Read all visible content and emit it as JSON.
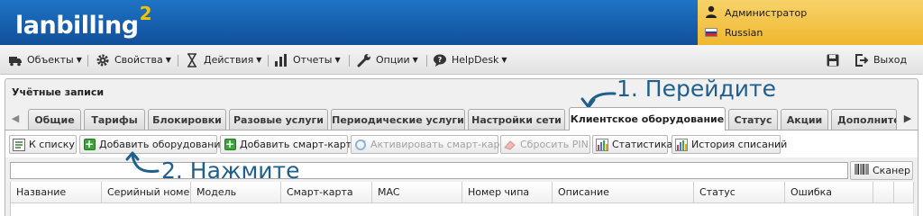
{
  "header": {
    "logo_text": "lanbilling",
    "logo_superscript": "2",
    "user": {
      "name": "Администратор",
      "icon": "user-icon"
    },
    "language": {
      "label": "Russian",
      "icon": "russian-flag-icon"
    },
    "colors": {
      "header_blue": "#175fae",
      "accent_yellow": "#f3c300"
    }
  },
  "menu": {
    "items": [
      {
        "label": "Объекты",
        "icon": "truck-icon"
      },
      {
        "label": "Свойства",
        "icon": "gear-icon"
      },
      {
        "label": "Действия",
        "icon": "hourglass-icon"
      },
      {
        "label": "Отчеты",
        "icon": "bar-chart-icon"
      },
      {
        "label": "Опции",
        "icon": "wrench-icon"
      },
      {
        "label": "HelpDesk",
        "icon": "speech-bubble-icon"
      }
    ],
    "logout_label": "Выход"
  },
  "panel": {
    "title": "Учётные записи"
  },
  "tabs": [
    {
      "label": "Общие"
    },
    {
      "label": "Тарифы"
    },
    {
      "label": "Блокировки"
    },
    {
      "label": "Разовые услуги"
    },
    {
      "label": "Периодические услуги"
    },
    {
      "label": "Настройки сети"
    },
    {
      "label": "Клиентское оборудование",
      "active": true
    },
    {
      "label": "Статус"
    },
    {
      "label": "Акции"
    },
    {
      "label": "Дополните"
    }
  ],
  "toolbar": {
    "buttons": [
      {
        "label": "К списку",
        "icon": "list-icon",
        "enabled": true
      },
      {
        "label": "Добавить оборудование",
        "icon": "plus-icon",
        "enabled": true
      },
      {
        "label": "Добавить смарт-карту",
        "icon": "plus-icon",
        "enabled": true
      },
      {
        "label": "Активировать смарт-карту",
        "icon": "refresh-icon",
        "enabled": false
      },
      {
        "label": "Сбросить PIN",
        "icon": "eraser-icon",
        "enabled": false
      },
      {
        "label": "Статистика",
        "icon": "bar-chart-icon",
        "enabled": true
      },
      {
        "label": "История списаний",
        "icon": "bar-chart-icon",
        "enabled": true
      }
    ]
  },
  "search": {
    "value": "",
    "scanner_label": "Сканер"
  },
  "grid": {
    "columns": [
      "Название",
      "Серийный номер",
      "Модель",
      "Смарт-карта",
      "MAC",
      "Номер чипа",
      "Описание",
      "Статус",
      "Ошибка"
    ]
  },
  "annotations": {
    "step1": "1. Перейдите",
    "step2": "2. Нажмите",
    "color": "#1e5f8e"
  }
}
